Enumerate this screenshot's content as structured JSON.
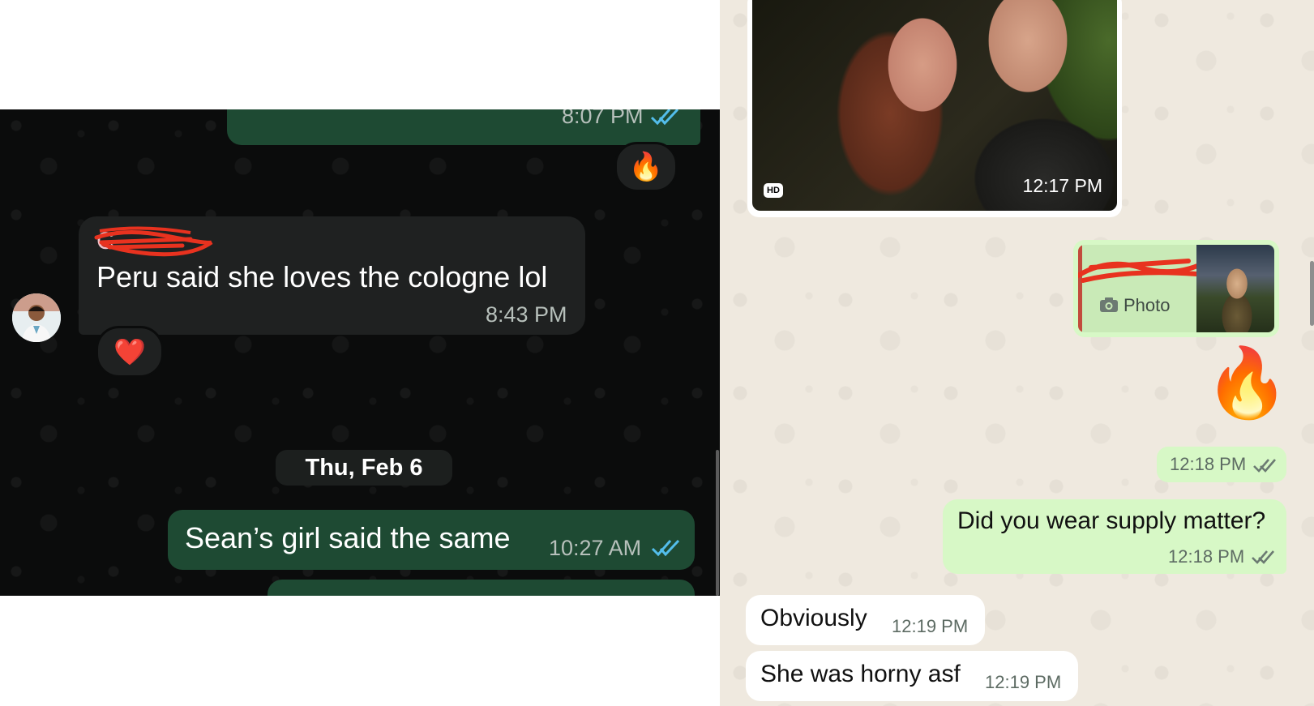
{
  "left_chat": {
    "msg_top": {
      "time": "8:07 PM",
      "reaction": "🔥"
    },
    "incoming": {
      "sender_redacted": "C",
      "text": "Peru said she loves the cologne lol",
      "time": "8:43 PM",
      "reaction": "❤️"
    },
    "date_separator": "Thu, Feb 6",
    "msg_bottom": {
      "text": "Sean’s girl said the same",
      "time": "10:27 AM"
    }
  },
  "right_chat": {
    "photo_message": {
      "hd_badge": "HD",
      "time": "12:17 PM"
    },
    "reply_message": {
      "quoted_label": "Photo",
      "emoji": "🔥",
      "time": "12:18 PM"
    },
    "out_message": {
      "text": "Did you wear supply matter?",
      "time": "12:18 PM"
    },
    "in_messages": [
      {
        "text": "Obviously",
        "time": "12:19 PM"
      },
      {
        "text": "She was horny asf",
        "time": "12:19 PM"
      }
    ]
  },
  "colors": {
    "dark_out_bubble": "#1e4a33",
    "dark_in_bubble": "#1f2121",
    "light_out_bubble": "#d7f8c6",
    "read_ticks_blue": "#53bdeb",
    "redaction_red": "#e8321f"
  }
}
